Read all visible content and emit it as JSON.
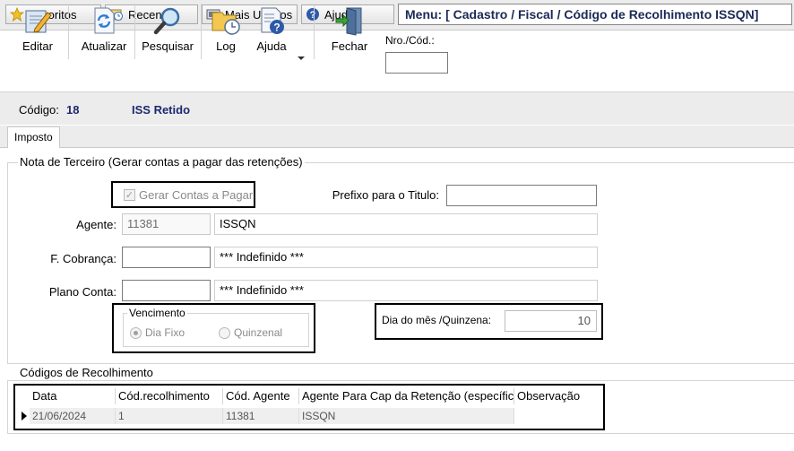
{
  "nav": {
    "items": [
      {
        "label": "Favoritos",
        "icon": "star-icon"
      },
      {
        "label": "Recente",
        "icon": "recent-icon"
      },
      {
        "label": "Mais Usados",
        "icon": "most-used-icon"
      },
      {
        "label": "Ajuda",
        "icon": "help-icon"
      }
    ],
    "menu_path": "Menu: [ Cadastro / Fiscal / Código de Recolhimento ISSQN]"
  },
  "toolbar": {
    "buttons": [
      {
        "label": "Editar",
        "icon": "edit-icon"
      },
      {
        "label": "Atualizar",
        "icon": "refresh-icon"
      },
      {
        "label": "Pesquisar",
        "icon": "search-icon"
      },
      {
        "label": "Log",
        "icon": "log-icon"
      },
      {
        "label": "Ajuda",
        "icon": "help-doc-icon"
      },
      {
        "label": "Fechar",
        "icon": "exit-door-icon"
      }
    ],
    "nro_cod_label": "Nro./Cód.:",
    "nro_cod_value": ""
  },
  "record": {
    "codigo_label": "Código:",
    "codigo_value": "18",
    "descricao": "ISS Retido"
  },
  "tabs": [
    "Imposto"
  ],
  "nota_terceiro": {
    "title": "Nota de Terceiro (Gerar contas a pagar das retenções)",
    "gerar_contas_label": "Gerar Contas a Pagar",
    "gerar_contas_checked": true,
    "prefixo_label": "Prefixo para o Titulo:",
    "prefixo_value": "",
    "agente_label": "Agente:",
    "agente_code": "11381",
    "agente_name": "ISSQN",
    "cobranca_label": "F. Cobrança:",
    "cobranca_code": "",
    "cobranca_name": "*** Indefinido ***",
    "plano_label": "Plano Conta:",
    "plano_code": "",
    "plano_name": "*** Indefinido ***",
    "vencimento_title": "Vencimento",
    "vencimento_options": [
      "Dia Fixo",
      "Quinzenal"
    ],
    "vencimento_selected": "Dia Fixo",
    "dia_mes_label": "Dia do mês /Quinzena:",
    "dia_mes_value": "10"
  },
  "codigos": {
    "title": "Códigos de Recolhimento",
    "columns": [
      "Data",
      "Cód.recolhimento",
      "Cód. Agente",
      "Agente Para Cap da Retenção (específico",
      "Observação"
    ],
    "rows": [
      [
        "21/06/2024",
        "1",
        "11381",
        "ISSQN",
        ""
      ]
    ]
  },
  "colors": {
    "accent_text": "#1b2a70",
    "highlight_border": "#000000"
  }
}
